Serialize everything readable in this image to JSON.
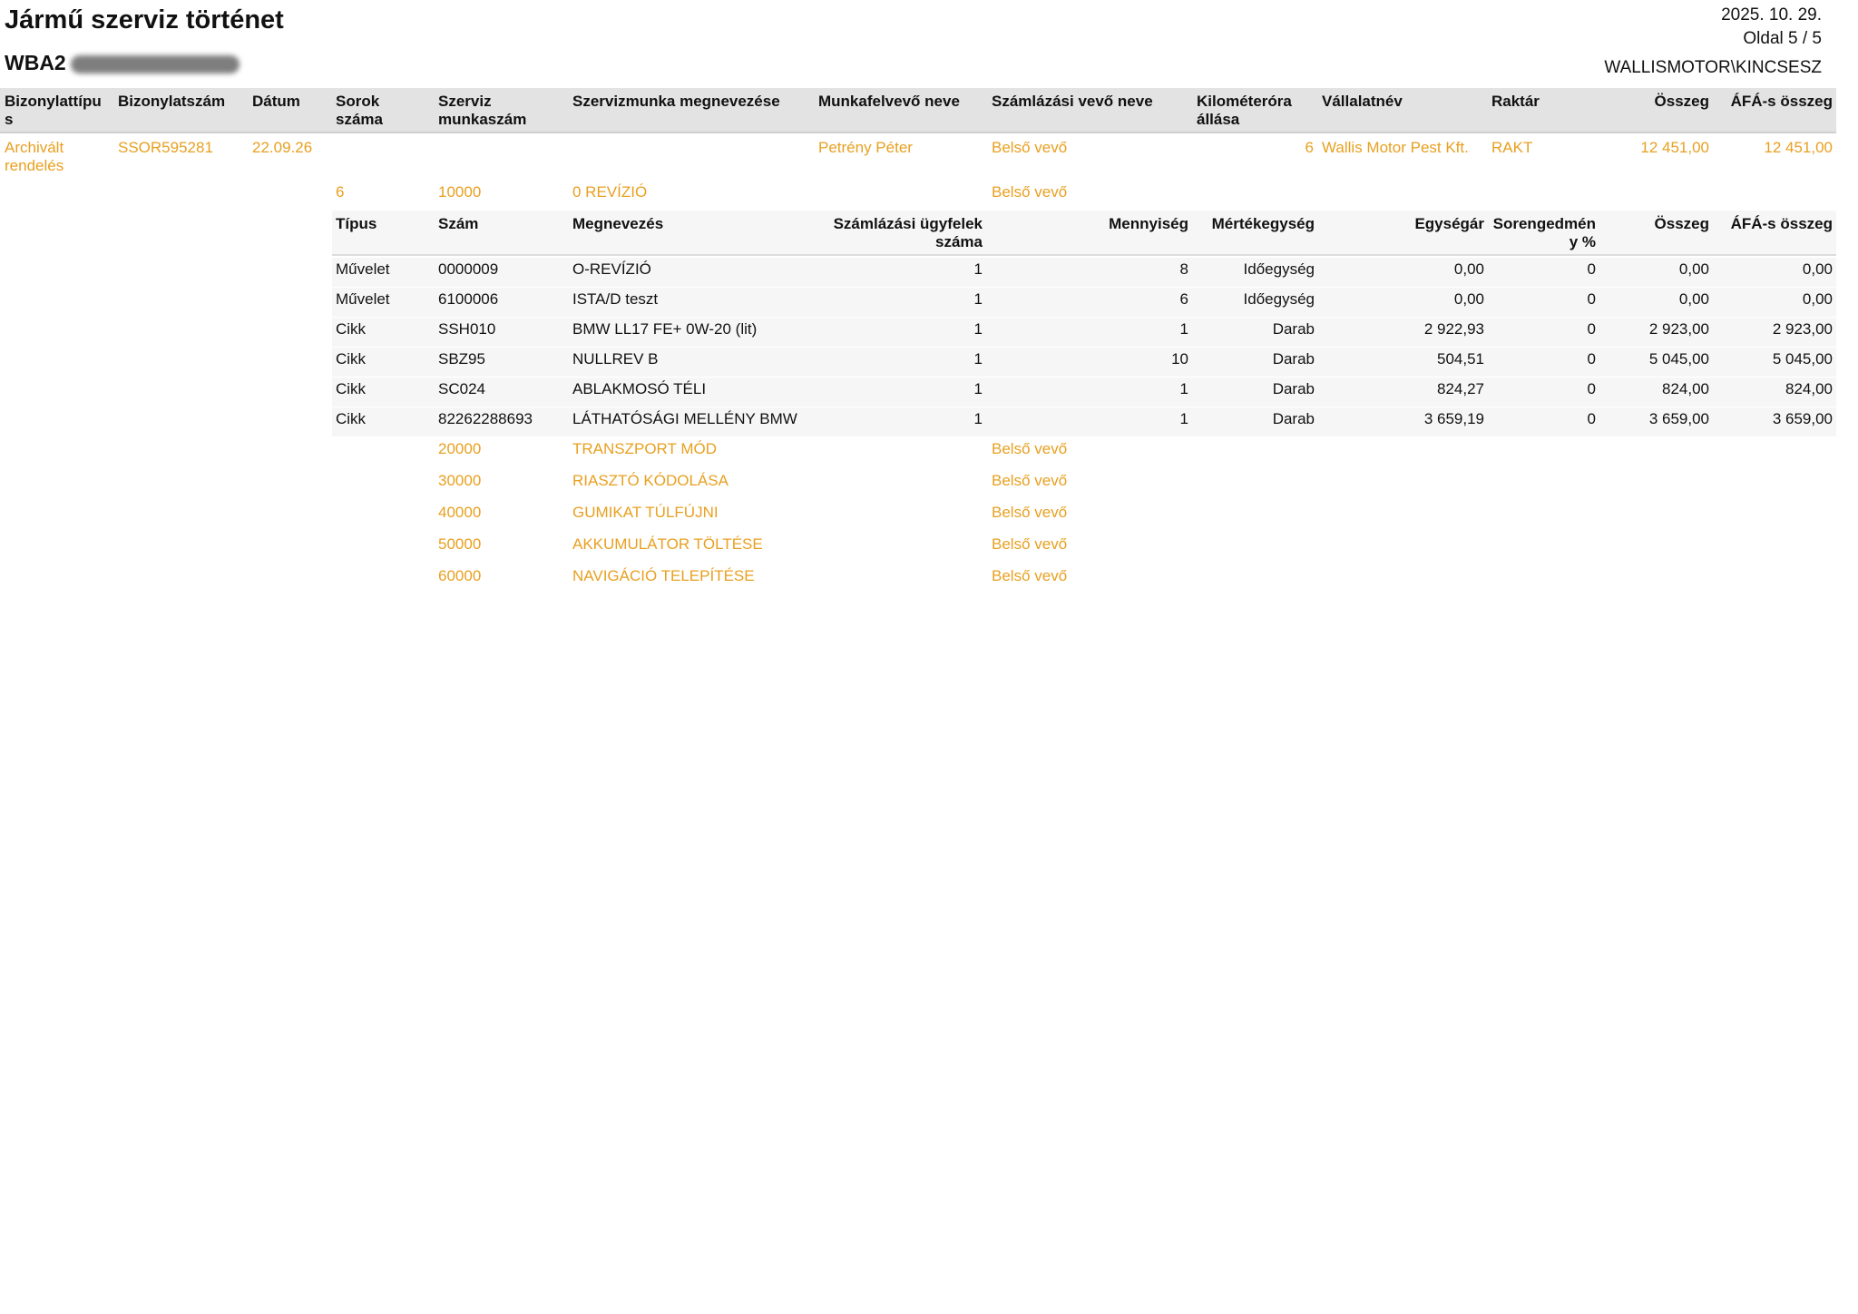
{
  "header": {
    "title": "Jármű szerviz történet",
    "vin_prefix": "WBA2",
    "date": "2025. 10. 29.",
    "page": "Oldal 5 / 5",
    "user": "WALLISMOTOR\\KINCSESZ"
  },
  "doc_columns": {
    "c1": "Bizonylattípus",
    "c2": "Bizonylatszám",
    "c3": "Dátum",
    "c4": "Sorok száma",
    "c5": "Szerviz munkaszám",
    "c6": "Szervizmunka megnevezése",
    "c7": "Munkafelvevő neve",
    "c8": "Számlázási vevő neve",
    "c9": "Kilométeróra állása",
    "c10": "Vállalatnév",
    "c11": "Raktár",
    "c12": "Összeg",
    "c13": "ÁFÁ-s összeg"
  },
  "doc_row": {
    "type": "Archivált rendelés",
    "number": "SSOR595281",
    "date": "22.09.26",
    "taker": "Petrény Péter",
    "customer": "Belső vevő",
    "km": "6",
    "company": "Wallis Motor Pest Kft.",
    "warehouse": "RAKT",
    "amount": "12 451,00",
    "amount_vat": "12 451,00"
  },
  "job_main": {
    "lines": "6",
    "job_no": "10000",
    "job_name": "0 REVÍZIÓ",
    "customer": "Belső vevő"
  },
  "item_columns": {
    "c1": "Típus",
    "c2": "Szám",
    "c3": "Megnevezés",
    "c4": "Számlázási ügyfelek száma",
    "c5": "Mennyiség",
    "c6": "Mértékegység",
    "c7": "Egységár",
    "c8": "Sorengedmény %",
    "c9": "Összeg",
    "c10": "ÁFÁ-s összeg"
  },
  "items": [
    {
      "type": "Művelet",
      "no": "0000009",
      "name": "O-REVÍZIÓ",
      "cust": "1",
      "qty": "8",
      "unit": "Időegység",
      "price": "0,00",
      "disc": "0",
      "amount": "0,00",
      "vat": "0,00"
    },
    {
      "type": "Művelet",
      "no": "6100006",
      "name": "ISTA/D teszt",
      "cust": "1",
      "qty": "6",
      "unit": "Időegység",
      "price": "0,00",
      "disc": "0",
      "amount": "0,00",
      "vat": "0,00"
    },
    {
      "type": "Cikk",
      "no": "SSH010",
      "name": "BMW LL17 FE+ 0W-20 (lit)",
      "cust": "1",
      "qty": "1",
      "unit": "Darab",
      "price": "2 922,93",
      "disc": "0",
      "amount": "2 923,00",
      "vat": "2 923,00"
    },
    {
      "type": "Cikk",
      "no": "SBZ95",
      "name": "NULLREV B",
      "cust": "1",
      "qty": "10",
      "unit": "Darab",
      "price": "504,51",
      "disc": "0",
      "amount": "5 045,00",
      "vat": "5 045,00"
    },
    {
      "type": "Cikk",
      "no": "SC024",
      "name": "ABLAKMOSÓ TÉLI",
      "cust": "1",
      "qty": "1",
      "unit": "Darab",
      "price": "824,27",
      "disc": "0",
      "amount": "824,00",
      "vat": "824,00"
    },
    {
      "type": "Cikk",
      "no": "82262288693",
      "name": "LÁTHATÓSÁGI MELLÉNY BMW",
      "cust": "1",
      "qty": "1",
      "unit": "Darab",
      "price": "3 659,19",
      "disc": "0",
      "amount": "3 659,00",
      "vat": "3 659,00"
    }
  ],
  "other_jobs": [
    {
      "job_no": "20000",
      "job_name": "TRANSZPORT MÓD",
      "customer": "Belső vevő"
    },
    {
      "job_no": "30000",
      "job_name": "RIASZTÓ KÓDOLÁSA",
      "customer": "Belső vevő"
    },
    {
      "job_no": "40000",
      "job_name": "GUMIKAT TÚLFÚJNI",
      "customer": "Belső vevő"
    },
    {
      "job_no": "50000",
      "job_name": "AKKUMULÁTOR TÖLTÉSE",
      "customer": "Belső vevő"
    },
    {
      "job_no": "60000",
      "job_name": "NAVIGÁCIÓ TELEPÍTÉSE",
      "customer": "Belső vevő"
    }
  ],
  "colors": {
    "accent_orange": "#e8a020",
    "header_band": "#e3e3e3",
    "row_band": "#f6f6f6"
  }
}
